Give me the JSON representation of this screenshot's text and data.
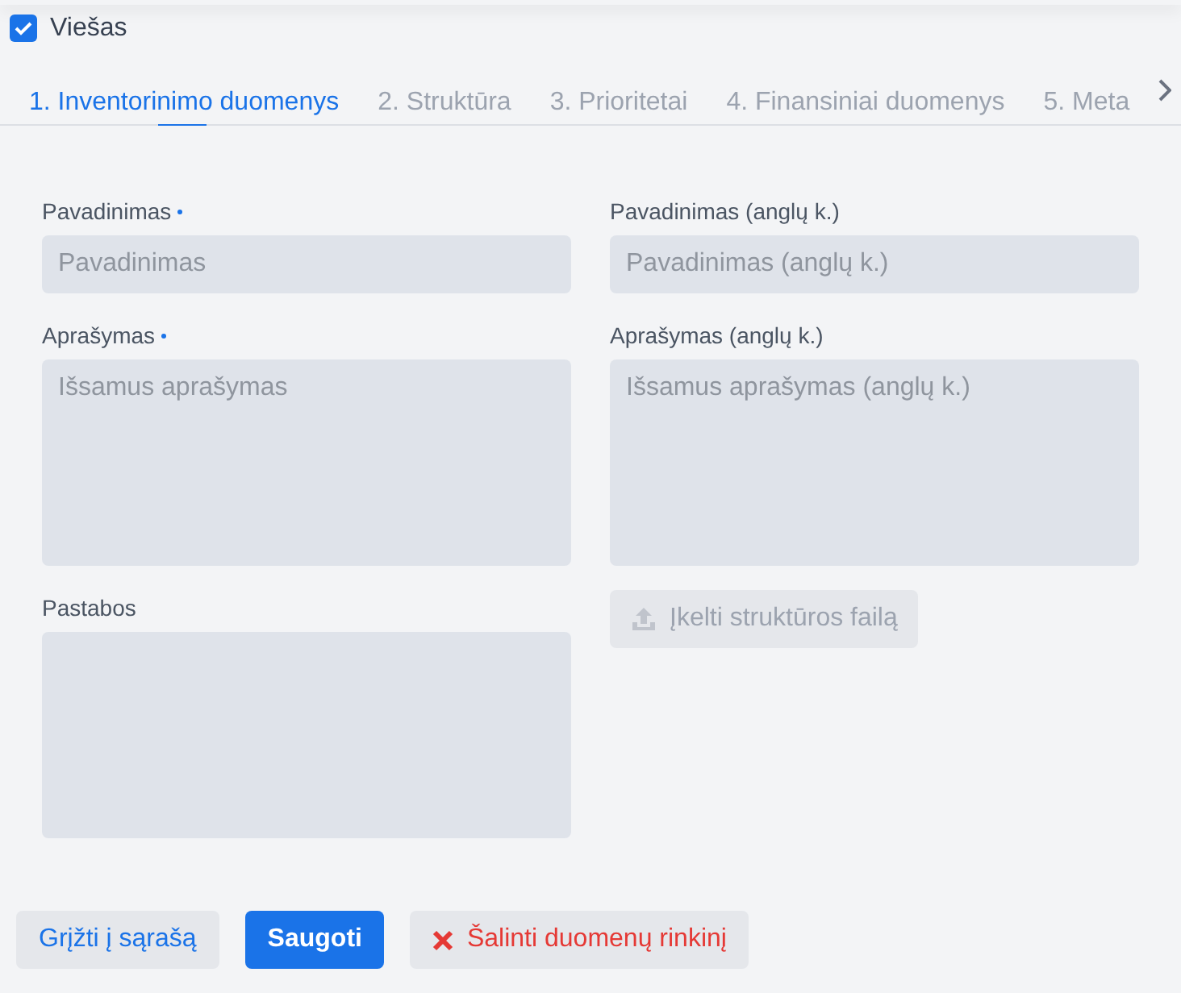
{
  "public_checkbox": {
    "label": "Viešas",
    "checked": true
  },
  "tabs": [
    {
      "label": "1. Inventorinimo duomenys",
      "selected": true
    },
    {
      "label": "2. Struktūra",
      "selected": false
    },
    {
      "label": "3. Prioritetai",
      "selected": false
    },
    {
      "label": "4. Finansiniai duomenys",
      "selected": false
    },
    {
      "label": "5. Meta",
      "selected": false
    }
  ],
  "left_fields": [
    {
      "kind": "input",
      "label": "Pavadinimas",
      "required": true,
      "placeholder": "Pavadinimas"
    },
    {
      "kind": "textarea",
      "label": "Aprašymas",
      "required": true,
      "placeholder": "Išsamus aprašymas"
    },
    {
      "kind": "textarea",
      "label": "Pastabos",
      "required": false
    }
  ],
  "right_fields": [
    {
      "kind": "input",
      "label": "Pavadinimas (anglų k.)",
      "required": false,
      "placeholder": "Pavadinimas (anglų k.)"
    },
    {
      "kind": "textarea",
      "label": "Aprašymas (anglų k.)",
      "required": false,
      "placeholder": "Išsamus aprašymas (anglų k.)"
    },
    {
      "kind": "upload",
      "label": "Įkelti struktūros failą",
      "disabled": true
    }
  ],
  "buttons": [
    {
      "kind": "secondary",
      "label": "Grįžti į sąrašą"
    },
    {
      "kind": "primary",
      "label": "Saugoti"
    },
    {
      "kind": "danger",
      "label": "Šalinti duomenų rinkinį"
    }
  ]
}
